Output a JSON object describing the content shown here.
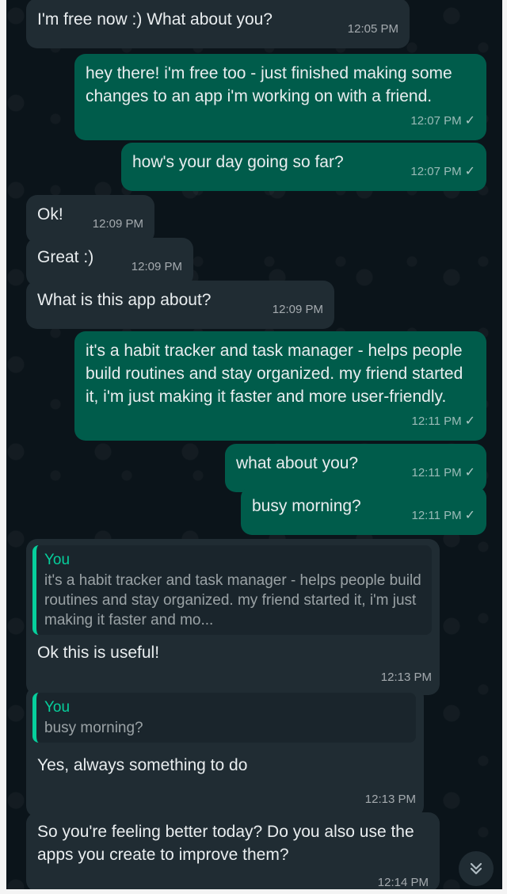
{
  "messages": [
    {
      "dir": "in",
      "text": "I'm free now :) What about you?",
      "time": "12:05 PM"
    },
    {
      "dir": "out",
      "text": "hey there! i'm free too - just finished making some changes to an app i'm working on with a friend.",
      "time": "12:07 PM",
      "status": "✓"
    },
    {
      "dir": "out",
      "text": "how's your day going so far?",
      "time": "12:07 PM",
      "status": "✓"
    },
    {
      "dir": "in",
      "text": "Ok!",
      "time": "12:09 PM"
    },
    {
      "dir": "in",
      "text": "Great :)",
      "time": "12:09 PM"
    },
    {
      "dir": "in",
      "text": "What is this app about?",
      "time": "12:09 PM"
    },
    {
      "dir": "out",
      "text": "it's a habit tracker and task manager - helps people build routines and stay organized. my friend started it, i'm just making it faster and more user-friendly.",
      "time": "12:11 PM",
      "status": "✓"
    },
    {
      "dir": "out",
      "text": "what about you?",
      "time": "12:11 PM",
      "status": "✓"
    },
    {
      "dir": "out",
      "text": "busy morning?",
      "time": "12:11 PM",
      "status": "✓"
    },
    {
      "dir": "in",
      "quote_author": "You",
      "quote_text": "it's a habit tracker and task manager - helps people build routines and stay organized. my friend started it, i'm just making it faster and mo...",
      "text": "Ok this is useful!",
      "time": "12:13 PM"
    },
    {
      "dir": "in",
      "quote_author": "You",
      "quote_text": "busy morning?",
      "text": "Yes, always something to do",
      "time": "12:13 PM"
    },
    {
      "dir": "in",
      "text": "So you're feeling better today? Do you also use the apps you create to improve them?",
      "time": "12:14 PM"
    }
  ],
  "icons": {
    "scroll_down": "double-chevron-down-icon",
    "read_receipt": "check-icon"
  },
  "colors": {
    "background": "#0b141a",
    "incoming": "#202c33",
    "outgoing": "#005c4b",
    "quote_accent": "#06cf9c"
  }
}
